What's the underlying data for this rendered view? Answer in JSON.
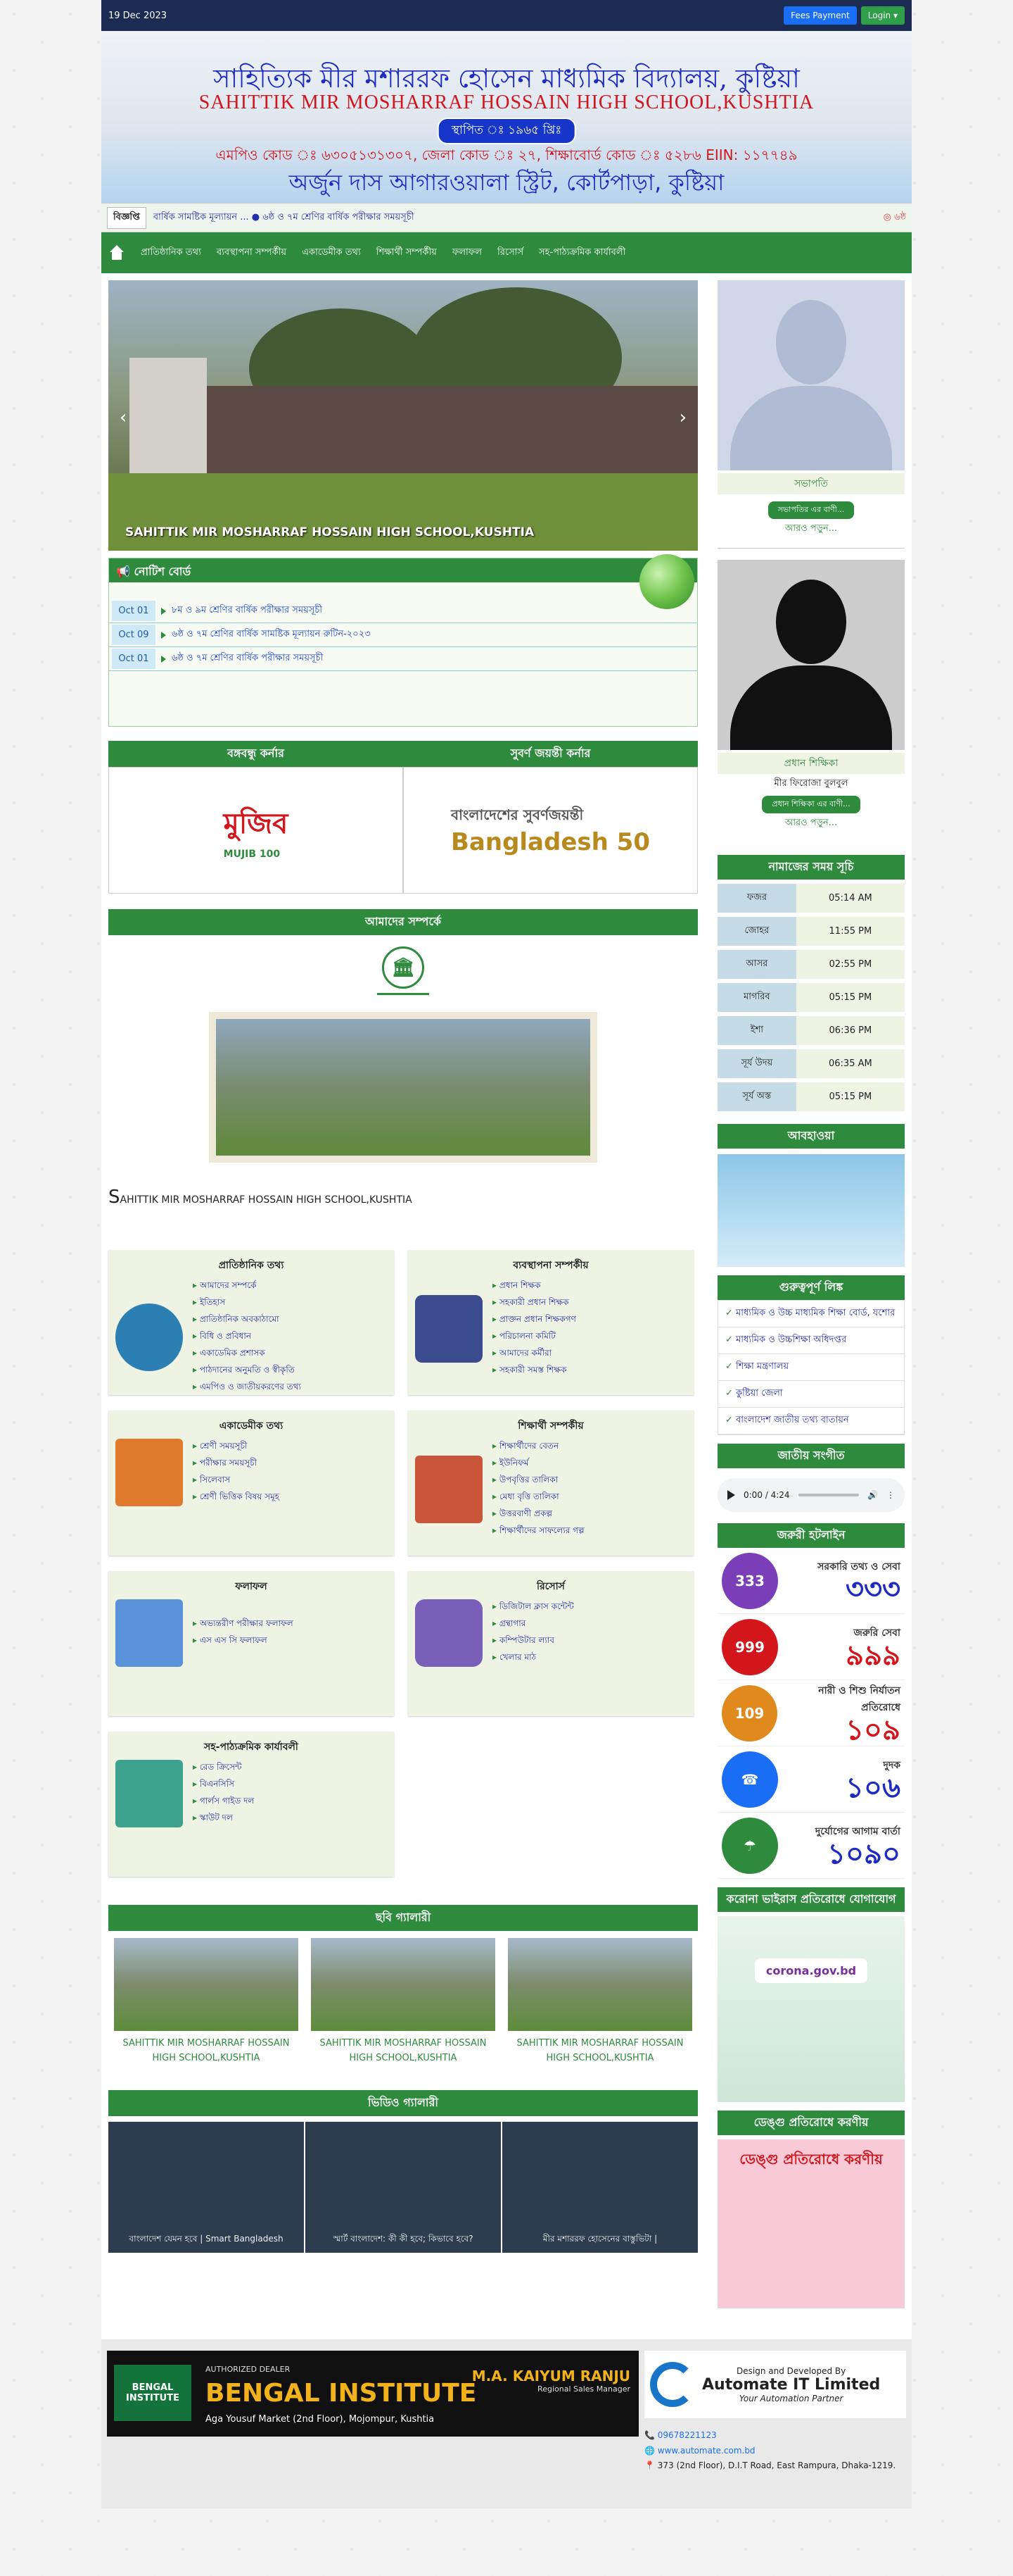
{
  "topbar": {
    "date": "19 Dec 2023",
    "fees_label": "Fees Payment",
    "login_label": "Login ▾"
  },
  "banner": {
    "title_bn": "সাহিত্যিক মীর মশাররফ হোসেন মাধ্যমিক বিদ্যালয়, কুষ্টিয়া",
    "title_en": "SAHITTIK MIR MOSHARRAF HOSSAIN  HIGH SCHOOL,KUSHTIA",
    "established": "স্থাপিত ঃ ১৯৬৫ খ্রিঃ",
    "codes": "এমপিও কোড ঃ ৬৩০৫১৩১৩০৭, জেলা কোড ঃ ২৭, শিক্ষাবোর্ড কোড ঃ ৫২৮৬ EIIN: ১১৭৭৪৯",
    "address": "অর্জুন দাস আগারওয়ালা স্ট্রিট, কোর্টপাড়া, কুষ্টিয়া"
  },
  "ticker": {
    "label": "বিজ্ঞপ্তি",
    "message": "বার্ষিক সামষ্টিক মূল্যায়ন ...  ● ৬ষ্ঠ ও ৭ম শ্রেণির বার্ষিক পরীক্ষার সময়সূচী",
    "controls": "◎ ৬ষ্ঠ"
  },
  "nav": [
    "প্রাতিষ্ঠানিক তথ্য",
    "ব্যবস্থাপনা সম্পর্কীয়",
    "একাডেমীক তথ্য",
    "শিক্ষার্থী সম্পর্কীয়",
    "ফলাফল",
    "রিসোর্স",
    "সহ-পাঠ্যক্রমিক কার্যাবলী"
  ],
  "slider": {
    "caption": "SAHITTIK MIR MOSHARRAF HOSSAIN HIGH SCHOOL,KUSHTIA"
  },
  "notice": {
    "title": "নোটিশ বোর্ড",
    "items": [
      {
        "date": "Oct 01",
        "text": "৮ম ও ৯ম শ্রেণির বার্ষিক পরীক্ষার সময়সূচী"
      },
      {
        "date": "Oct 09",
        "text": "৬ষ্ঠ ও ৭ম শ্রেণির বার্ষিক সামষ্টিক মূল্যায়ন রুটিন-২০২৩"
      },
      {
        "date": "Oct 01",
        "text": "৬ষ্ঠ ও ৭ম শ্রেণির বার্ষিক পরীক্ষার সময়সূচী"
      }
    ]
  },
  "corners": {
    "left_title": "বঙ্গবন্ধু কর্নার",
    "left_img": "মুজিব",
    "left_sub": "MUJIB 100",
    "right_title": "সুবর্ণ জয়ন্তী কর্নার",
    "right_img": "বাংলাদেশের সুবর্ণজয়ন্তী",
    "right_sub": "Bangladesh 50"
  },
  "about": {
    "title": "আমাদের সম্পর্কে",
    "first": "S",
    "name": "AHITTIK MIR MOSHARRAF HOSSAIN HIGH SCHOOL,KUSHTIA"
  },
  "cards": [
    {
      "title": "প্রাতিষ্ঠানিক তথ্য",
      "color": "#2b7fb3",
      "items": [
        "আমাদের সম্পর্কে",
        "ইতিহাস",
        "প্রাতিষ্ঠানিক অবকাঠামো",
        "বিধি ও প্রবিধান",
        "একাডেমিক প্রশাসক",
        "পাঠদানের অনুমতি ও স্বীকৃতি",
        "এমপিও ও জাতীয়করণের তথ্য"
      ]
    },
    {
      "title": "ব্যবস্থাপনা সম্পর্কীয়",
      "color": "#3b4b8f",
      "items": [
        "প্রধান শিক্ষক",
        "সহকারী প্রধান শিক্ষক",
        "প্রাক্তন প্রধান শিক্ষকগণ",
        "পরিচালনা কমিটি",
        "আমাদের কর্মীরা",
        "সহকারী সমস্ত শিক্ষক"
      ]
    },
    {
      "title": "একাডেমীক তথ্য",
      "color": "#e07b2e",
      "items": [
        "শ্রেণী সময়সূচী",
        "পরীক্ষার সময়সূচী",
        "সিলেবাস",
        "শ্রেণী ভিত্তিক বিষয় সমূহ"
      ]
    },
    {
      "title": "শিক্ষার্থী সম্পর্কীয়",
      "color": "#c9553b",
      "items": [
        "শিক্ষার্থীদের বেতন",
        "ইউনিফর্ম",
        "উপবৃত্তির তালিকা",
        "মেধা বৃত্তি তালিকা",
        "উত্তরবাণী প্রকল্প",
        "শিক্ষার্থীদের সাফল্যের গল্প"
      ]
    },
    {
      "title": "ফলাফল",
      "color": "#5a93d9",
      "items": [
        "অভ্যন্তরীণ পরীক্ষার ফলাফল",
        "এস এস সি ফলাফল"
      ]
    },
    {
      "title": "রিসোর্স",
      "color": "#7a5fb8",
      "items": [
        "ডিজিটাল ক্লাস কন্টেন্ট",
        "গ্রন্থাগার",
        "কম্পিউটার ল্যাব",
        "খেলার মাঠ"
      ]
    },
    {
      "title": "সহ-পাঠ্যক্রমিক কার্যাবলী",
      "color": "#3da38e",
      "items": [
        "রেড ক্রিসেন্ট",
        "বিএনসিসি",
        "গার্লস গাইড দল",
        "স্কাউট দল"
      ]
    }
  ],
  "gallery": {
    "title": "ছবি গ্যালারী",
    "items": [
      "SAHITTIK MIR MOSHARRAF HOSSAIN HIGH SCHOOL,KUSHTIA",
      "SAHITTIK MIR MOSHARRAF HOSSAIN HIGH SCHOOL,KUSHTIA",
      "SAHITTIK MIR MOSHARRAF HOSSAIN HIGH SCHOOL,KUSHTIA"
    ]
  },
  "video": {
    "title": "ভিডিও গ্যালারী",
    "items": [
      "বাংলাদেশ যেমন হবে | Smart Bangladesh",
      "স্মার্ট বাংলাদেশ: কী কী হবে; কিভাবে হবে?",
      "মীর মশাররফ হোসেনের বাস্তুভিটা |"
    ]
  },
  "side": {
    "president": {
      "role": "সভাপতি",
      "name": "",
      "msg": "সভাপতির এর বাণী...",
      "more": "আরও পড়ুন..."
    },
    "head": {
      "role": "প্রধান শিক্ষিকা",
      "name": "মীর ফিরোজা বুলবুল",
      "msg": "প্রধান শিক্ষিকা এর বাণী...",
      "more": "আরও পড়ুন..."
    },
    "prayer_title": "নামাজের সময় সূচি",
    "prayer": [
      {
        "k": "ফজর",
        "v": "05:14 AM"
      },
      {
        "k": "জোহর",
        "v": "11:55 PM"
      },
      {
        "k": "আসর",
        "v": "02:55 PM"
      },
      {
        "k": "মাগরিব",
        "v": "05:15 PM"
      },
      {
        "k": "ইশা",
        "v": "06:36 PM"
      },
      {
        "k": "সূর্য উদয়",
        "v": "06:35 AM"
      },
      {
        "k": "সূর্য অস্ত",
        "v": "05:15 PM"
      }
    ],
    "weather_title": "আবহাওয়া",
    "links_title": "গুরুত্বপূর্ণ লিঙ্ক",
    "links": [
      "মাধ্যমিক ও উচ্চ মাধ্যমিক শিক্ষা বোর্ড, যশোর",
      "মাধ্যমিক ও উচ্চশিক্ষা অধিদপ্তর",
      "শিক্ষা মন্ত্রণালয়",
      "কুষ্টিয়া জেলা",
      "বাংলাদেশ জাতীয় তথ্য বাতায়ন"
    ],
    "anthem_title": "জাতীয় সংগীত",
    "audio_time": "0:00 / 4:24",
    "hotline_title": "জরুরী হটলাইন",
    "hotlines": [
      {
        "icon": "333",
        "sub": "সরকারি তথ্য ও সেবা",
        "num": "৩৩৩",
        "color": "#7a3fb8",
        "red": false
      },
      {
        "icon": "999",
        "sub": "জরুরি সেবা",
        "num": "৯৯৯",
        "color": "#d2161c",
        "red": true
      },
      {
        "icon": "109",
        "sub": "নারী ও শিশু নির্যাতন প্রতিরোধে",
        "num": "১০৯",
        "color": "#e08a1e",
        "red": true
      },
      {
        "icon": "☎",
        "sub": "দুদক",
        "num": "১০৬",
        "color": "#1a6ef5",
        "red": false
      },
      {
        "icon": "☂",
        "sub": "দুর্যোগের আগাম বার্তা",
        "num": "১০৯০",
        "color": "#2e8b3e",
        "red": false
      }
    ],
    "corona_title": "করোনা ভাইরাস প্রতিরোধে যোগাযোগ",
    "corona_text": "corona.gov.bd",
    "dengue_title": "ডেঙ্গু প্রতিরোধে করণীয়",
    "dengue_text": "ডেঙ্গু প্রতিরোধে করণীয়"
  },
  "footer": {
    "ad_logo": "BENGAL INSTITUTE",
    "ad_dealer": "AUTHORIZED DEALER",
    "ad_name": "BENGAL INSTITUTE",
    "ad_address": "Aga Yousuf Market (2nd Floor), Mojompur, Kushtia",
    "ad_person": "M.A. KAIYUM RANJU",
    "ad_person_sub": "Regional Sales Manager",
    "dev_label": "Design and Developed By",
    "dev_name": "Automate IT Limited",
    "dev_tag": "Your Automation Partner",
    "phone": "09678221123",
    "web": "www.automate.com.bd",
    "addr": "373 (2nd Floor), D.I.T Road, East Rampura, Dhaka-1219."
  }
}
